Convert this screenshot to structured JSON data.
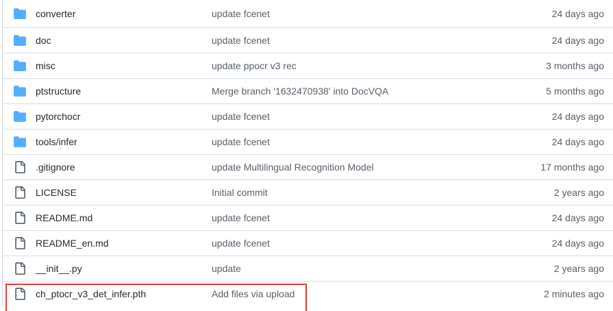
{
  "files": [
    {
      "type": "folder",
      "icon": "folder-icon",
      "name": "converter",
      "message": "update fcenet",
      "age": "24 days ago"
    },
    {
      "type": "folder",
      "icon": "folder-icon",
      "name": "doc",
      "message": "update fcenet",
      "age": "24 days ago"
    },
    {
      "type": "folder",
      "icon": "folder-icon",
      "name": "misc",
      "message": "update ppocr v3 rec",
      "age": "3 months ago"
    },
    {
      "type": "folder",
      "icon": "folder-icon",
      "name": "ptstructure",
      "message": "Merge branch '1632470938' into DocVQA",
      "age": "5 months ago"
    },
    {
      "type": "folder",
      "icon": "folder-icon",
      "name": "pytorchocr",
      "message": "update fcenet",
      "age": "24 days ago"
    },
    {
      "type": "folder",
      "icon": "folder-icon",
      "name": "tools/infer",
      "message": "update fcenet",
      "age": "24 days ago"
    },
    {
      "type": "file",
      "icon": "file-icon",
      "name": ".gitignore",
      "message": "update Multilingual Recognition Model",
      "age": "17 months ago"
    },
    {
      "type": "file",
      "icon": "file-icon",
      "name": "LICENSE",
      "message": "Initial commit",
      "age": "2 years ago"
    },
    {
      "type": "file",
      "icon": "file-icon",
      "name": "README.md",
      "message": "update fcenet",
      "age": "24 days ago"
    },
    {
      "type": "file",
      "icon": "file-icon",
      "name": "README_en.md",
      "message": "update fcenet",
      "age": "24 days ago"
    },
    {
      "type": "file",
      "icon": "file-icon",
      "name": "__init__.py",
      "message": "update",
      "age": "2 years ago"
    },
    {
      "type": "file",
      "icon": "file-icon",
      "name": "ch_ptocr_v3_det_infer.pth",
      "message": "Add files via upload",
      "age": "2 minutes ago"
    }
  ],
  "colors": {
    "folder": "#54aeff",
    "file_stroke": "#57606a",
    "highlight": "#e53935",
    "border": "#d8dee4"
  }
}
